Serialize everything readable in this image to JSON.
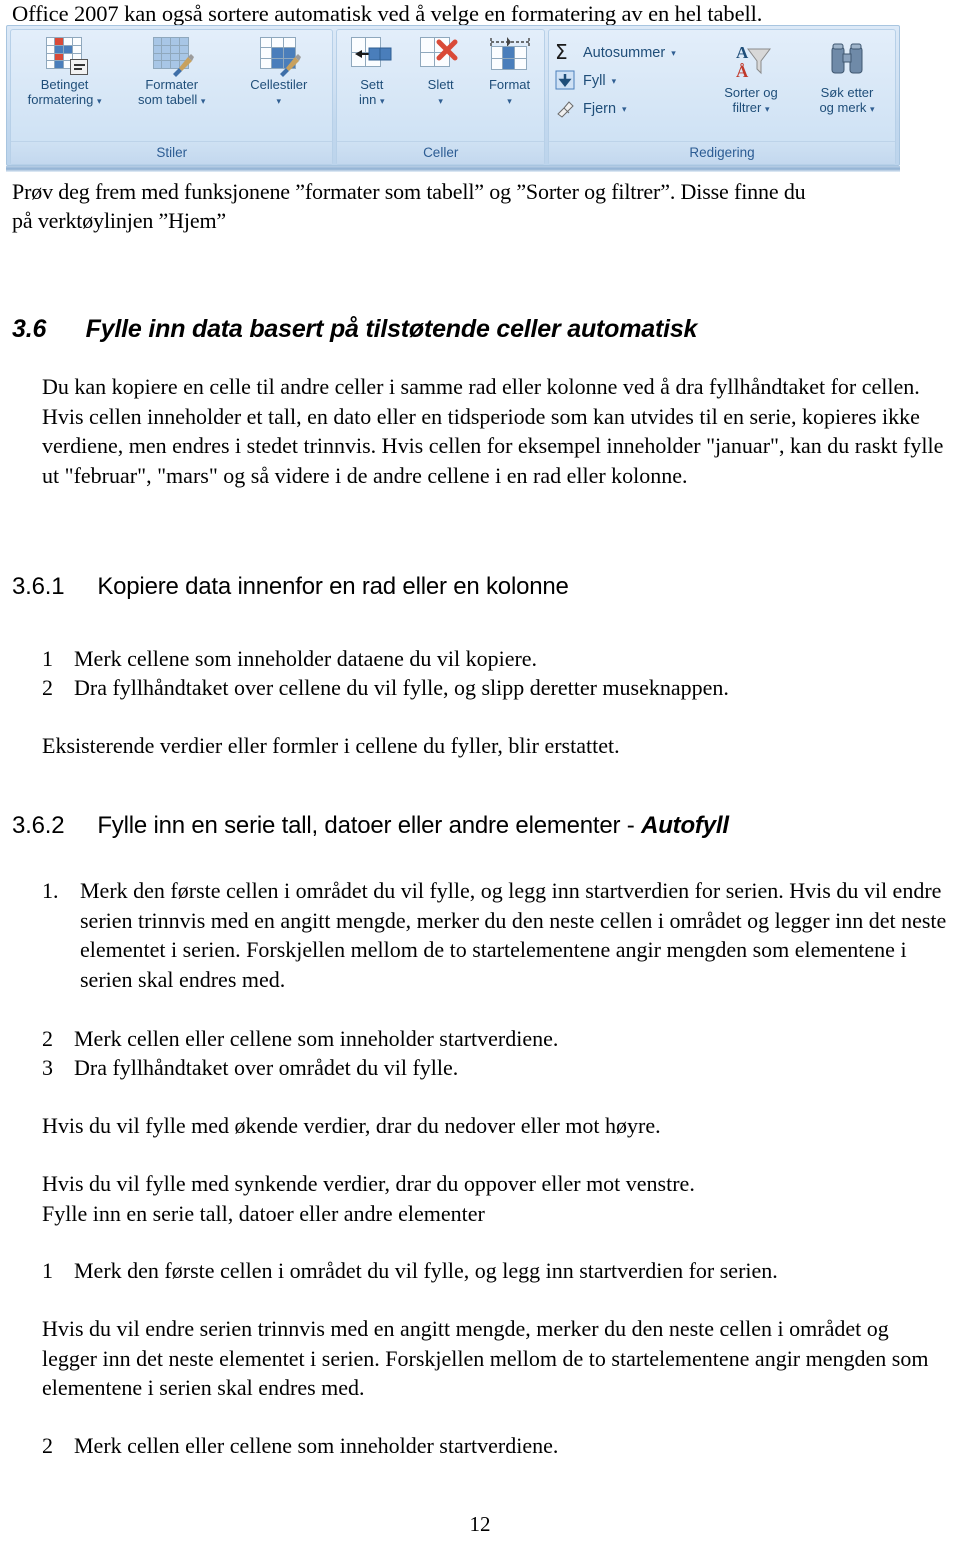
{
  "document": {
    "intro_line": "Office 2007 kan også sortere automatisk ved å velge en formatering av en hel tabell.",
    "page_number": "12"
  },
  "ribbon": {
    "groups": [
      {
        "name": "Stiler",
        "footer_label": "Stiler",
        "buttons": [
          {
            "label_line1": "Betinget",
            "label_line2": "formatering",
            "has_caret": true,
            "icon": "conditional-formatting-icon"
          },
          {
            "label_line1": "Formater",
            "label_line2": "som tabell",
            "has_caret": true,
            "icon": "format-as-table-icon"
          },
          {
            "label_line1": "Cellestiler",
            "label_line2": "",
            "has_caret": true,
            "icon": "cell-styles-icon"
          }
        ]
      },
      {
        "name": "Celler",
        "footer_label": "Celler",
        "buttons": [
          {
            "label_line1": "Sett",
            "label_line2": "inn",
            "has_caret": true,
            "icon": "insert-cells-icon"
          },
          {
            "label_line1": "Slett",
            "label_line2": "",
            "has_caret": true,
            "icon": "delete-cells-icon"
          },
          {
            "label_line1": "Format",
            "label_line2": "",
            "has_caret": true,
            "icon": "format-cells-icon"
          }
        ]
      },
      {
        "name": "Redigering",
        "footer_label": "Redigering",
        "small_buttons": [
          {
            "label": "Autosummer",
            "has_caret": true,
            "icon": "autosum-sigma-icon"
          },
          {
            "label": "Fyll",
            "has_caret": true,
            "icon": "fill-down-arrow-icon"
          },
          {
            "label": "Fjern",
            "has_caret": true,
            "icon": "eraser-icon"
          }
        ],
        "large_buttons": [
          {
            "label_line1": "Sorter og",
            "label_line2": "filtrer",
            "has_caret": true,
            "icon": "sort-and-filter-icon"
          },
          {
            "label_line1": "Søk etter",
            "label_line2": "og merk",
            "has_caret": true,
            "icon": "find-and-select-binoculars-icon"
          }
        ]
      }
    ]
  },
  "body": {
    "caption_line1": "Prøv deg frem med funksjonene ”formater som tabell” og ”Sorter og filtrer”. Disse finne du",
    "caption_line2": "på verktøylinjen ”Hjem”",
    "section_36_number": "3.6",
    "section_36_title": "Fylle inn data basert på tilstøtende celler automatisk",
    "section_36_paragraph": "Du kan kopiere en celle til andre celler i samme rad eller kolonne ved å dra fyllhåndtaket for cellen. Hvis cellen inneholder et tall, en dato eller en tidsperiode som kan utvides til en serie, kopieres ikke verdiene, men endres i stedet trinnvis. Hvis cellen for eksempel inneholder \"januar\", kan du raskt fylle ut \"februar\", \"mars\" og så videre i de andre cellene i en rad eller kolonne.",
    "section_361_number": "3.6.1",
    "section_361_title": "Kopiere data innenfor en rad eller en kolonne",
    "section_361_steps": [
      {
        "num": "1",
        "text": "Merk cellene som inneholder dataene du vil kopiere."
      },
      {
        "num": "2",
        "text": "Dra fyllhåndtaket over cellene du vil fylle, og slipp deretter museknappen."
      }
    ],
    "section_361_note": "Eksisterende verdier eller formler i cellene du fyller, blir erstattet.",
    "section_362_number": "3.6.2",
    "section_362_title_plain": "Fylle inn en serie tall, datoer eller andre elementer - ",
    "section_362_title_bold": "Autofyll",
    "section_362_step1_num": "1.",
    "section_362_step1_text": "Merk den første cellen i området du vil fylle, og legg inn startverdien for serien. Hvis du vil endre serien trinnvis med en angitt mengde, merker du den neste cellen i området og legger inn det neste elementet i serien. Forskjellen mellom de to startelementene angir mengden som elementene i serien skal endres med.",
    "section_362_step2_num": "2",
    "section_362_step2_text": "Merk cellen eller cellene som inneholder startverdiene.",
    "section_362_step3_num": "3",
    "section_362_step3_text": "Dra fyllhåndtaket over området du vil fylle.",
    "note_increasing": "Hvis du vil fylle med økende verdier, drar du nedover eller mot høyre.",
    "note_decreasing": "Hvis du vil fylle med synkende verdier, drar du oppover eller mot venstre.",
    "repeat_heading": "Fylle inn en serie tall, datoer eller andre elementer",
    "repeat_step1_num": "1",
    "repeat_step1_text": "Merk den første cellen i området du vil fylle, og legg inn startverdien for serien.",
    "repeat_paragraph": "Hvis du vil endre serien trinnvis med en angitt mengde, merker du den neste cellen i området og legger inn det neste elementet i serien. Forskjellen mellom de to startelementene angir mengden som elementene i serien skal endres med.",
    "repeat_step2_num": "2",
    "repeat_step2_text": "Merk cellen eller cellene som inneholder startverdiene."
  }
}
